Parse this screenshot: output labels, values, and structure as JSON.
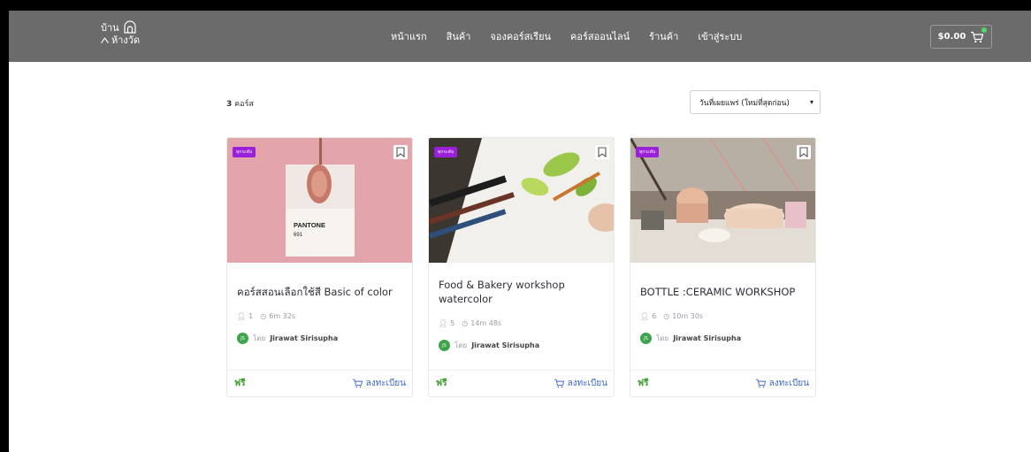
{
  "header": {
    "logo_line1": "บ้าน",
    "logo_line2": "ห้างวัด",
    "nav": [
      "หน้าแรก",
      "สินค้า",
      "จองคอร์สเรียน",
      "คอร์สออนไลน์",
      "ร้านค้า",
      "เข้าสู่ระบบ"
    ],
    "cart_total": "$0.00"
  },
  "toolbar": {
    "count_number": "3",
    "count_label": "คอร์ส",
    "sort_selected": "วันที่เผยแพร่ (ใหม่ที่สุดก่อน)"
  },
  "courses": [
    {
      "badge": "ทุกระดับ",
      "title": "คอร์สสอนเลือกใช้สี Basic of color",
      "students": "1",
      "duration": "6m 32s",
      "by": "โดย",
      "author": "Jirawat Sirisupha",
      "avatar": "JS",
      "price": "ฟรี",
      "enroll": "ลงทะเบียน",
      "image_text": [
        "PANTONE",
        "691"
      ]
    },
    {
      "badge": "ทุกระดับ",
      "title": "Food & Bakery workshop watercolor",
      "students": "5",
      "duration": "14m 48s",
      "by": "โดย",
      "author": "Jirawat Sirisupha",
      "avatar": "JS",
      "price": "ฟรี",
      "enroll": "ลงทะเบียน"
    },
    {
      "badge": "ทุกระดับ",
      "title": "BOTTLE :CERAMIC WORKSHOP",
      "students": "6",
      "duration": "10m 30s",
      "by": "โดย",
      "author": "Jirawat Sirisupha",
      "avatar": "JS",
      "price": "ฟรี",
      "enroll": "ลงทะเบียน"
    }
  ]
}
